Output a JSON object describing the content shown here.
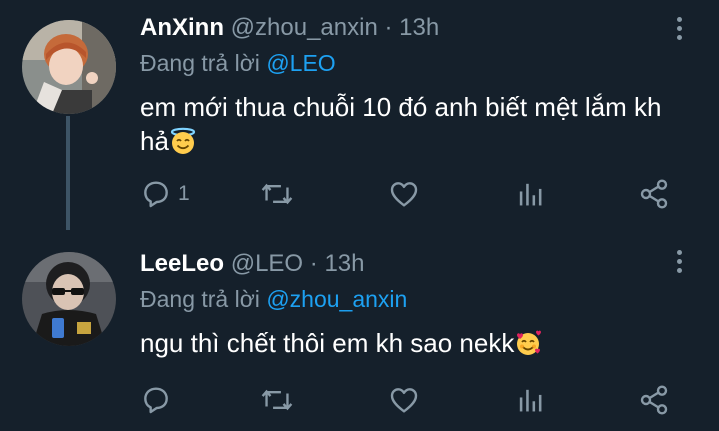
{
  "theme": {
    "background": "#15202b",
    "text": "#ffffff",
    "muted": "#8899a6",
    "accent": "#1da1f2",
    "thread_line": "#3d5466"
  },
  "tweets": [
    {
      "display_name": "AnXinn",
      "handle": "@zhou_anxin",
      "separator": "·",
      "time": "13h",
      "reply_prefix": "Đang trả lời",
      "reply_to": "@LEO",
      "text": "em mới thua chuỗi 10 đó anh biết mệt lắm kh hả",
      "emoji": "smiling-face-with-halo",
      "actions": {
        "reply_count": "1",
        "retweet_count": "",
        "like_count": ""
      }
    },
    {
      "display_name": "LeeLeo",
      "handle": "@LEO",
      "separator": "·",
      "time": "13h",
      "reply_prefix": "Đang trả lời",
      "reply_to": "@zhou_anxin",
      "text": "ngu thì chết thôi em kh sao nekk",
      "emoji": "smiling-face-with-hearts",
      "actions": {
        "reply_count": "",
        "retweet_count": "",
        "like_count": ""
      }
    }
  ],
  "icons": [
    "reply-icon",
    "retweet-icon",
    "like-icon",
    "analytics-icon",
    "share-icon",
    "more-icon"
  ]
}
